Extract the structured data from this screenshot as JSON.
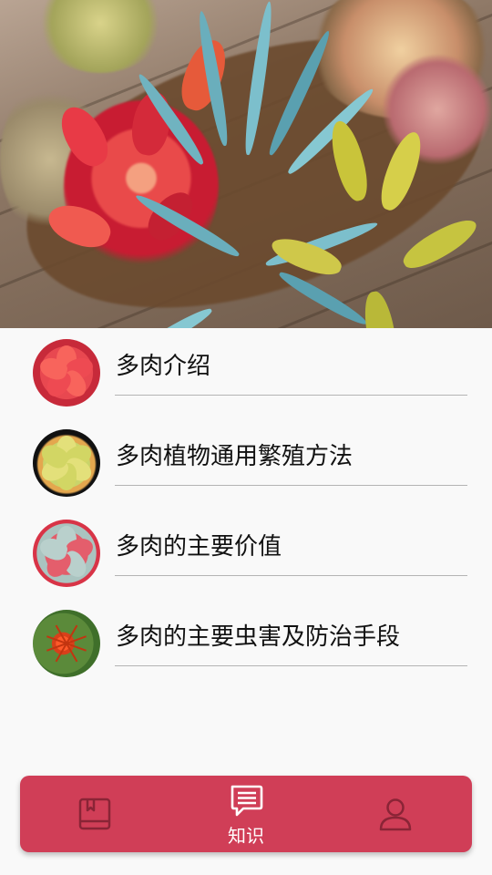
{
  "list": {
    "items": [
      {
        "label": "多肉介绍",
        "thumb_icon": "red-succulent-thumbnail"
      },
      {
        "label": "多肉植物通用繁殖方法",
        "thumb_icon": "yellow-succulent-thumbnail"
      },
      {
        "label": "多肉的主要价值",
        "thumb_icon": "pink-succulent-thumbnail"
      },
      {
        "label": "多肉的主要虫害及防治手段",
        "thumb_icon": "red-spider-mite-thumbnail"
      }
    ]
  },
  "bottom_nav": {
    "items": [
      {
        "icon": "book-icon",
        "label": ""
      },
      {
        "icon": "chat-lines-icon",
        "label": "知识",
        "active": true
      },
      {
        "icon": "person-icon",
        "label": ""
      }
    ]
  },
  "colors": {
    "nav_background": "#d03e57",
    "nav_icon_inactive": "#8a2436",
    "nav_icon_active": "#ffffff",
    "divider": "#b4b4b4"
  }
}
